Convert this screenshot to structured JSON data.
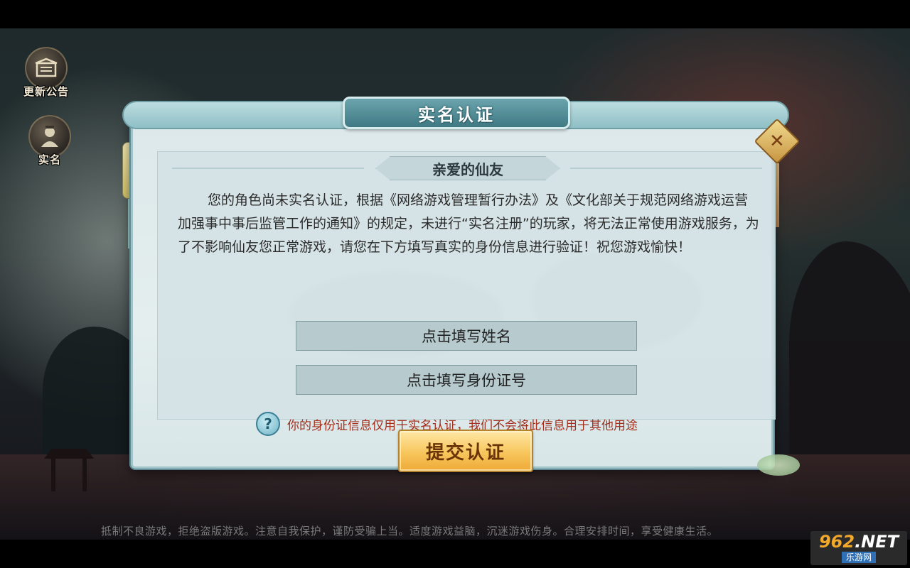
{
  "sidebar": {
    "announcement_label": "更新公告",
    "realname_label": "实名"
  },
  "dialog": {
    "title": "实名认证",
    "subtitle": "亲爱的仙友",
    "notice": "您的角色尚未实名认证，根据《网络游戏管理暂行办法》及《文化部关于规范网络游戏运营加强事中事后监管工作的通知》的规定，未进行“实名注册”的玩家，将无法正常使用游戏服务，为了不影响仙友您正常游戏，请您在下方填写真实的身份信息进行验证！祝您游戏愉快！",
    "name_field_placeholder": "点击填写姓名",
    "id_field_placeholder": "点击填写身份证号",
    "privacy_note": "你的身份证信息仅用于实名认证，我们不会将此信息用于其他用途",
    "submit_label": "提交认证",
    "close_symbol": "✕",
    "help_symbol": "?"
  },
  "footer": {
    "health_notice": "抵制不良游戏，拒绝盗版游戏。注意自我保护，谨防受骗上当。适度游戏益脑，沉迷游戏伤身。合理安排时间，享受健康生活。"
  },
  "watermark": {
    "number": "962",
    "suffix": ".NET",
    "caption": "乐游网"
  },
  "colors": {
    "submit_gold": "#f7c65c",
    "privacy_red": "#a32f1c",
    "title_teal": "#3f7983"
  },
  "icons": {
    "announcement": "notice-board-icon",
    "realname": "person-portrait-icon",
    "close": "close-icon",
    "help": "question-mark-icon"
  }
}
